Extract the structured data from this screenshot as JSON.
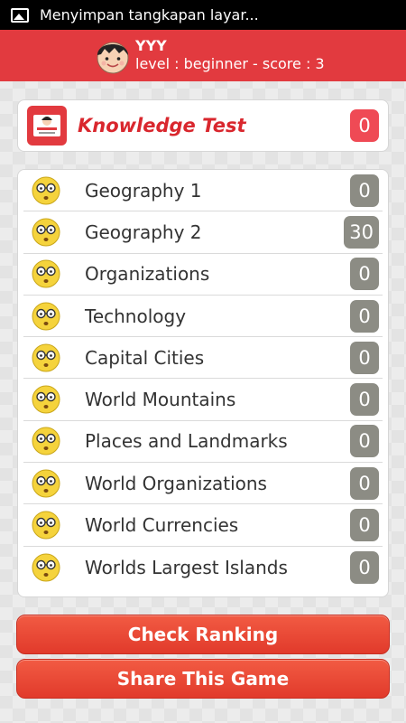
{
  "status_bar": {
    "notification_text": "Menyimpan tangkapan layar..."
  },
  "user": {
    "name": "YYY",
    "meta": "level : beginner - score : 3"
  },
  "test": {
    "title": "Knowledge Test",
    "score": "0"
  },
  "categories": [
    {
      "label": "Geography 1",
      "score": "0"
    },
    {
      "label": "Geography 2",
      "score": "30"
    },
    {
      "label": "Organizations",
      "score": "0"
    },
    {
      "label": "Technology",
      "score": "0"
    },
    {
      "label": "Capital Cities",
      "score": "0"
    },
    {
      "label": "World Mountains",
      "score": "0"
    },
    {
      "label": "Places and Landmarks",
      "score": "0"
    },
    {
      "label": "World Organizations",
      "score": "0"
    },
    {
      "label": "World Currencies",
      "score": "0"
    },
    {
      "label": "Worlds Largest Islands",
      "score": "0"
    }
  ],
  "buttons": {
    "check_ranking": "Check Ranking",
    "share_game": "Share This Game"
  },
  "colors": {
    "header": "#e23a3f",
    "score_red": "#ef4a55",
    "score_gray": "#8c8c84",
    "button": "#e8452f"
  },
  "icons": {
    "status": "image-icon",
    "avatar": "avatar-icon",
    "category": "nerd-emoji-icon"
  }
}
